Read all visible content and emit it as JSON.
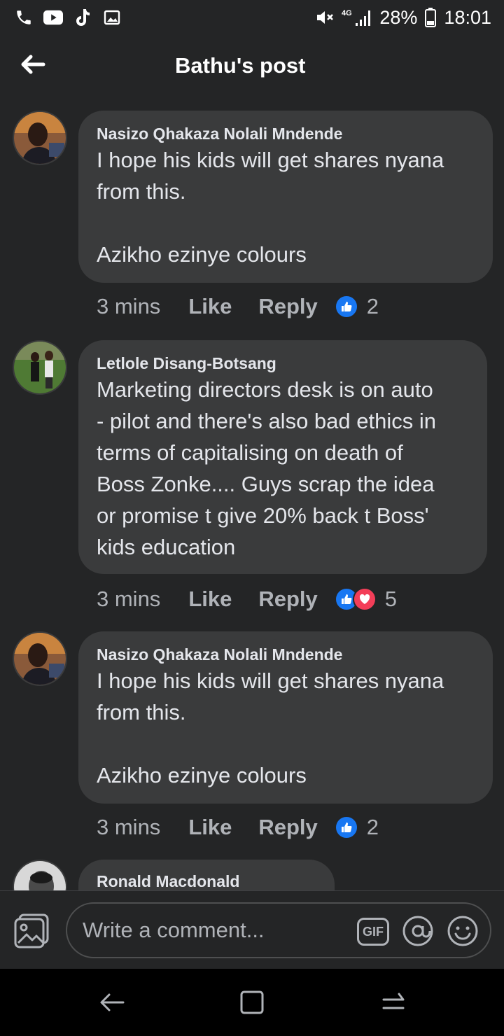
{
  "status_bar": {
    "battery": "28%",
    "time": "18:01",
    "network": "4G",
    "icons": [
      "phone-icon",
      "youtube-icon",
      "tiktok-icon",
      "gallery-icon",
      "mute-icon",
      "signal-icon",
      "battery-icon"
    ]
  },
  "header": {
    "title": "Bathu's post",
    "back_icon": "arrow-left-icon"
  },
  "comments": [
    {
      "author": "Nasizo Qhakaza Nolali Mndende",
      "text": "I hope his kids will get shares nyana\nfrom this.\n\nAzikho ezinye colours",
      "time": "3 mins",
      "like_label": "Like",
      "reply_label": "Reply",
      "reactions": [
        "like"
      ],
      "reaction_count": "2"
    },
    {
      "author": "Letlole Disang-Botsang",
      "text": "Marketing directors desk is on auto\n- pilot and there's also bad ethics in\nterms of capitalising on death of\nBoss Zonke.... Guys scrap the idea\nor promise t give 20% back t Boss'\nkids education",
      "time": "3 mins",
      "like_label": "Like",
      "reply_label": "Reply",
      "reactions": [
        "like",
        "love"
      ],
      "reaction_count": "5"
    },
    {
      "author": "Nasizo Qhakaza Nolali Mndende",
      "text": "I hope his kids will get shares nyana\nfrom this.\n\nAzikho ezinye colours",
      "time": "3 mins",
      "like_label": "Like",
      "reply_label": "Reply",
      "reactions": [
        "like"
      ],
      "reaction_count": "2"
    },
    {
      "author": "Ronald Macdonald"
    }
  ],
  "composer": {
    "placeholder": "Write a comment...",
    "gif_label": "GIF"
  },
  "colors": {
    "background": "#242526",
    "bubble": "#3a3b3c",
    "like_blue": "#1877f2",
    "love_red": "#f33e58"
  }
}
